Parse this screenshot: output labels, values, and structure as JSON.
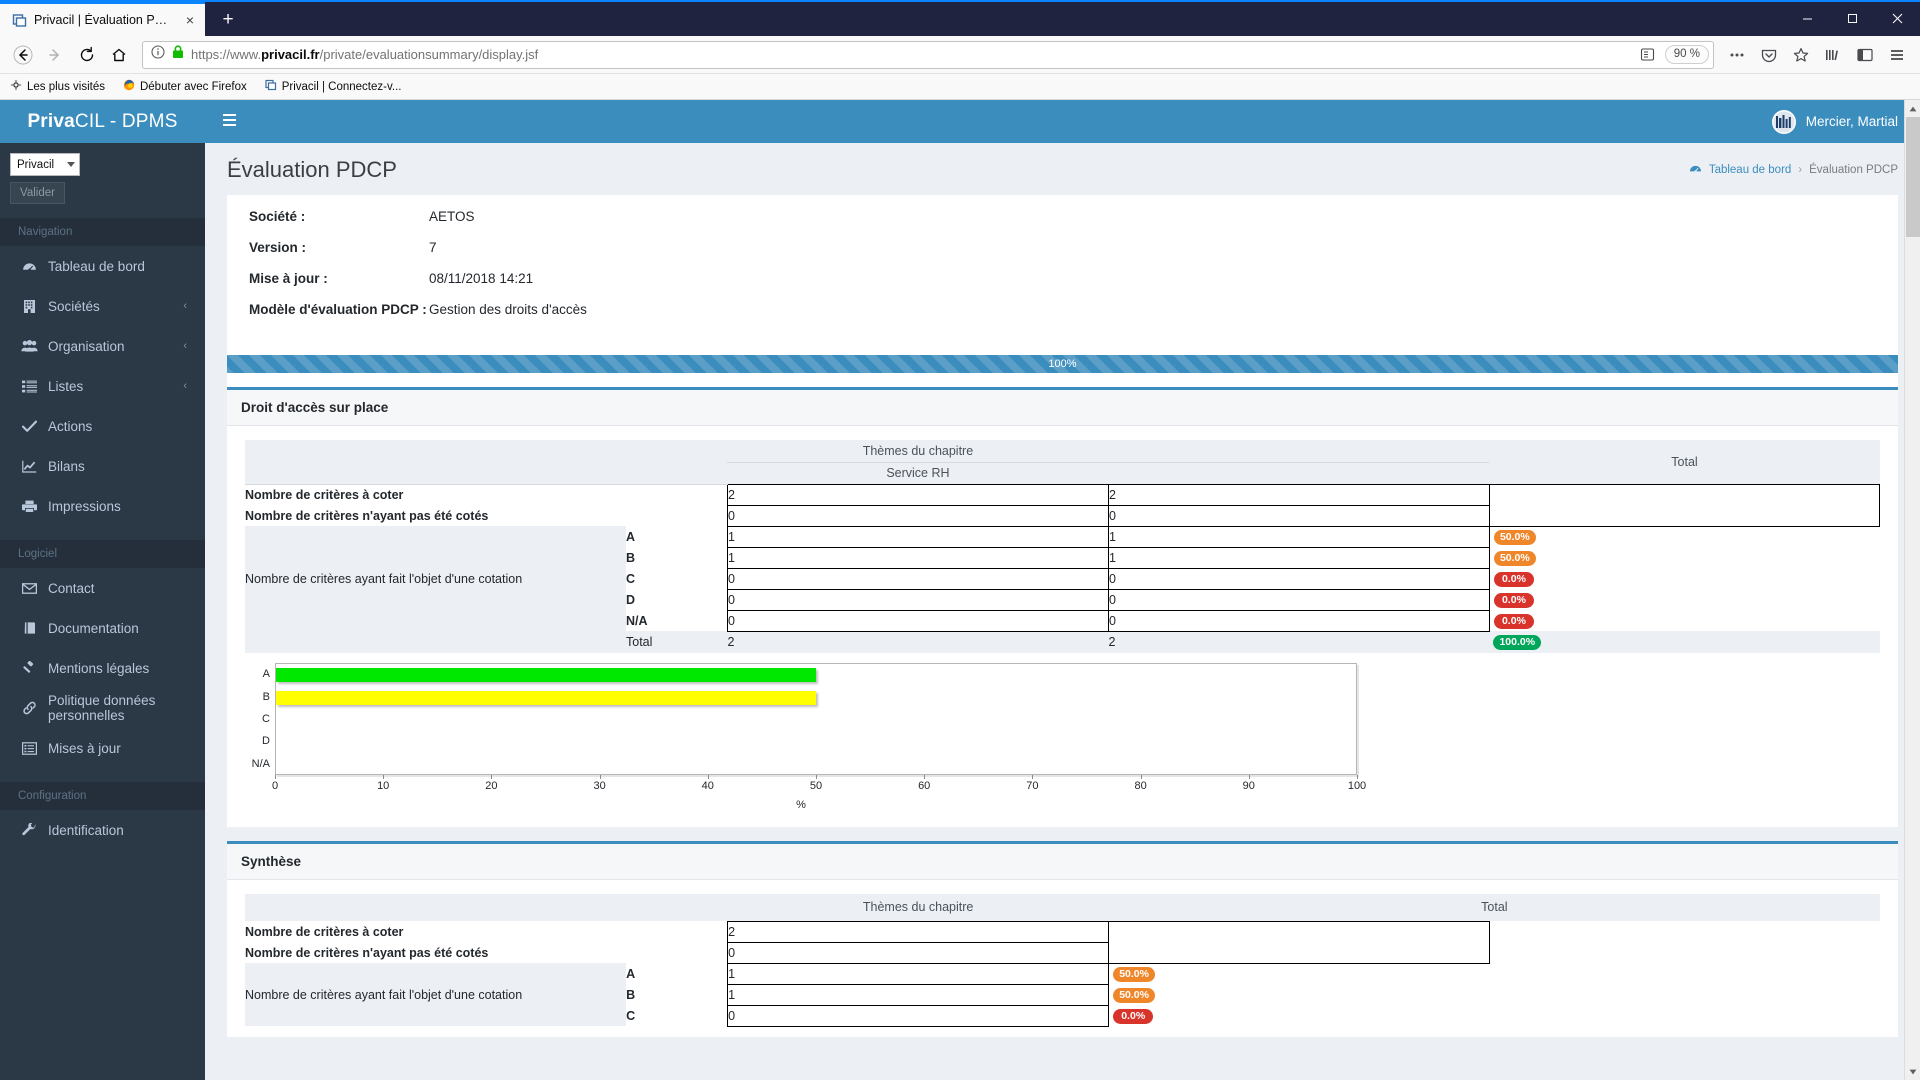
{
  "browser": {
    "tab": {
      "title": "Privacil | Évaluation PDCP",
      "favicon": "privacil-favicon",
      "close": "×"
    },
    "newtab_label": "+",
    "window_controls": {
      "minimize": "—",
      "maximize": "▢",
      "close": "✕"
    },
    "nav": {
      "back": "←",
      "forward": "→",
      "reload": "⟳",
      "home": "⌂"
    },
    "url": {
      "scheme": "https://www.",
      "domain": "privacil.fr",
      "path": "/private/evaluationsummary/display.jsf",
      "full": "https://www.privacil.fr/private/evaluationsummary/display.jsf"
    },
    "zoom_level": "90 %",
    "bookmarks": [
      {
        "label": "Les plus visités",
        "icon": "star-gear-icon"
      },
      {
        "label": "Débuter avec Firefox",
        "icon": "firefox-icon"
      },
      {
        "label": "Privacil | Connectez-v...",
        "icon": "privacil-favicon"
      }
    ]
  },
  "app": {
    "brand_bold": "Priva",
    "brand_light": "CIL - DPMS",
    "user_name": "Mercier, Martial",
    "accent": "#3b8dbd",
    "sidebar_bg": "#2b3947"
  },
  "sidebar": {
    "company_select": {
      "value": "Privacil"
    },
    "validate_label": "Valider",
    "sections": [
      {
        "header": "Navigation",
        "items": [
          {
            "label": "Tableau de bord",
            "icon": "dashboard-icon",
            "chevron": ""
          },
          {
            "label": "Sociétés",
            "icon": "building-icon",
            "chevron": "‹"
          },
          {
            "label": "Organisation",
            "icon": "users-icon",
            "chevron": "‹"
          },
          {
            "label": "Listes",
            "icon": "list-icon",
            "chevron": "‹"
          },
          {
            "label": "Actions",
            "icon": "check-icon",
            "chevron": ""
          },
          {
            "label": "Bilans",
            "icon": "chart-line-icon",
            "chevron": ""
          },
          {
            "label": "Impressions",
            "icon": "printer-icon",
            "chevron": ""
          }
        ]
      },
      {
        "header": "Logiciel",
        "items": [
          {
            "label": "Contact",
            "icon": "envelope-icon",
            "chevron": ""
          },
          {
            "label": "Documentation",
            "icon": "book-icon",
            "chevron": ""
          },
          {
            "label": "Mentions légales",
            "icon": "gavel-icon",
            "chevron": ""
          },
          {
            "label": "Politique données personnelles",
            "icon": "link-icon",
            "chevron": ""
          },
          {
            "label": "Mises à jour",
            "icon": "listalt-icon",
            "chevron": ""
          }
        ]
      },
      {
        "header": "Configuration",
        "items": [
          {
            "label": "Identification",
            "icon": "wrench-icon",
            "chevron": ""
          }
        ]
      }
    ]
  },
  "page": {
    "title": "Évaluation PDCP",
    "breadcrumb": {
      "home_icon": "dashboard-icon",
      "home": "Tableau de bord",
      "sep": "›",
      "current": "Évaluation PDCP"
    },
    "info": [
      {
        "key": "Société :",
        "value": "AETOS"
      },
      {
        "key": "Version :",
        "value": "7"
      },
      {
        "key": "Mise à jour :",
        "value": "08/11/2018 14:21"
      },
      {
        "key": "Modèle d'évaluation PDCP :",
        "value": "Gestion des droits d'accès"
      }
    ],
    "progress": {
      "label": "100%",
      "percent": 100,
      "color": "#3b8dbd"
    }
  },
  "panel_droit": {
    "title": "Droit d'accès sur place",
    "table": {
      "headers": {
        "blank": "",
        "themes": "Thèmes du chapitre",
        "service": "Service RH",
        "total": "Total"
      },
      "rows": [
        {
          "label": "Nombre de critères à coter",
          "service": "2",
          "sub": "2",
          "badge": "",
          "badge_color": ""
        },
        {
          "label": "Nombre de critères n'ayant pas été cotés",
          "service": "0",
          "sub": "0",
          "badge": "",
          "badge_color": ""
        }
      ],
      "cotation_label": "Nombre de critères ayant fait l'objet d'une cotation",
      "grades": [
        {
          "grade": "A",
          "service": "1",
          "sub": "1",
          "badge": "50.0%",
          "badge_color": "orange"
        },
        {
          "grade": "B",
          "service": "1",
          "sub": "1",
          "badge": "50.0%",
          "badge_color": "orange"
        },
        {
          "grade": "C",
          "service": "0",
          "sub": "0",
          "badge": "0.0%",
          "badge_color": "red"
        },
        {
          "grade": "D",
          "service": "0",
          "sub": "0",
          "badge": "0.0%",
          "badge_color": "red"
        },
        {
          "grade": "N/A",
          "service": "0",
          "sub": "0",
          "badge": "0.0%",
          "badge_color": "red"
        }
      ],
      "total": {
        "label": "Total",
        "service": "2",
        "sub": "2",
        "badge": "100.0%",
        "badge_color": "green"
      }
    }
  },
  "panel_synthese": {
    "title": "Synthèse",
    "table": {
      "headers": {
        "blank": "",
        "themes": "Thèmes du chapitre",
        "total": "Total"
      },
      "rows": [
        {
          "label": "Nombre de critères à coter",
          "value": "2",
          "badge": "",
          "badge_color": ""
        },
        {
          "label": "Nombre de critères n'ayant pas été cotés",
          "value": "0",
          "badge": "",
          "badge_color": ""
        }
      ],
      "cotation_label": "Nombre de critères ayant fait l'objet d'une cotation",
      "grades": [
        {
          "grade": "A",
          "value": "1",
          "badge": "50.0%",
          "badge_color": "orange"
        },
        {
          "grade": "B",
          "value": "1",
          "badge": "50.0%",
          "badge_color": "orange"
        },
        {
          "grade": "C",
          "value": "0",
          "badge": "0.0%",
          "badge_color": "red"
        }
      ]
    }
  },
  "chart_data": {
    "type": "bar",
    "orientation": "horizontal",
    "title": "",
    "xlabel": "%",
    "ylabel": "",
    "categories": [
      "A",
      "B",
      "C",
      "D",
      "N/A"
    ],
    "values": [
      50,
      50,
      0,
      0,
      0
    ],
    "colors": [
      "#00e800",
      "#ffff00",
      "#ff0000",
      "#8b0000",
      "#999999"
    ],
    "xlim": [
      0,
      100
    ],
    "xticks": [
      0,
      10,
      20,
      30,
      40,
      50,
      60,
      70,
      80,
      90,
      100
    ],
    "grid": false,
    "legend": false
  }
}
